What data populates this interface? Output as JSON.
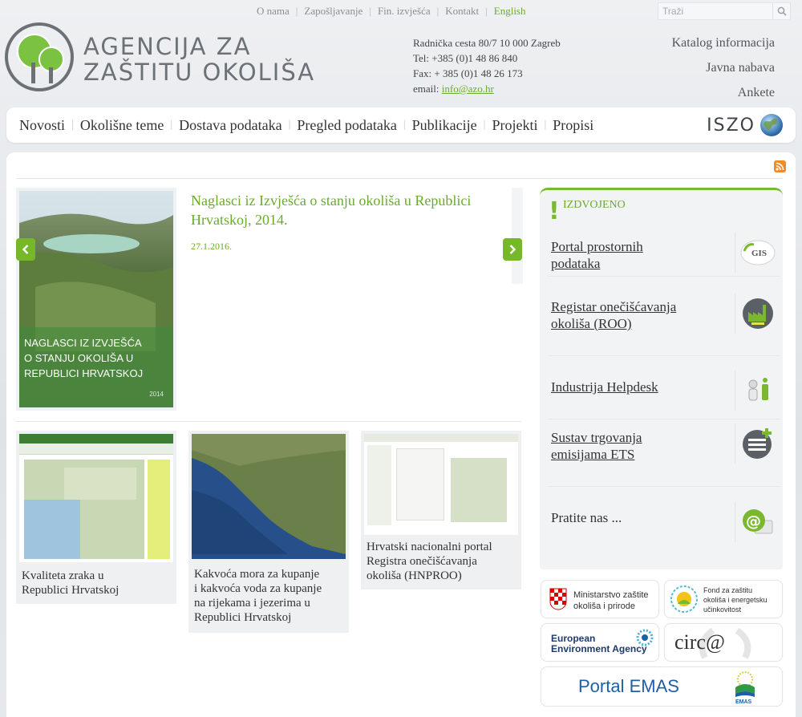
{
  "topnav": {
    "items": [
      "O nama",
      "Zapošljavanje",
      "Fin. izvješća",
      "Kontakt",
      "English"
    ],
    "search_placeholder": "Traži"
  },
  "header": {
    "brand_line1": "AGENCIJA ZA",
    "brand_line2": "ZAŠTITU OKOLIŠA",
    "address": "Radnička cesta 80/7 10 000 Zagreb",
    "tel": "Tel: +385 (0)1 48 86 840",
    "fax": "Fax: + 385 (0)1 48 26 173",
    "email_label": "email:",
    "email": "info@azo.hr",
    "quicklinks": [
      "Katalog informacija",
      "Javna nabava",
      "Ankete"
    ]
  },
  "mainnav": {
    "items": [
      "Novosti",
      "Okolišne teme",
      "Dostava podataka",
      "Pregled podataka",
      "Publikacije",
      "Projekti",
      "Propisi"
    ],
    "iszo": "ISZO"
  },
  "featured": {
    "title": "Naglasci iz Izvješća o stanju okoliša u Republici Hrvatskoj, 2014.",
    "date": "27.1.2016.",
    "cover_text": [
      "NAGLASCI IZ IZVJEŠĆA",
      "O STANJU OKOLIŠA U",
      "REPUBLICI HRVATSKOJ"
    ],
    "cover_year": "2014"
  },
  "cards": [
    {
      "caption": [
        "Kvaliteta zraka u",
        "Republici Hrvatskoj"
      ]
    },
    {
      "caption": [
        "Kakvoća mora za kupanje",
        "i kakvoća voda za kupanje",
        "na rijekama i jezerima u",
        "Republici Hrvatskoj"
      ]
    },
    {
      "caption": [
        "Hrvatski nacionalni portal",
        "Registra onečišćavanja",
        "okoliša (HNPROO)"
      ]
    }
  ],
  "sidebar": {
    "heading": "IZDVOJENO",
    "items": [
      {
        "label": [
          "Portal prostornih",
          "podataka"
        ],
        "icon_text": "GIS"
      },
      {
        "label": [
          "Registar onečišćavanja",
          "okoliša (ROO)"
        ],
        "icon_text": ""
      },
      {
        "label": [
          "Industrija Helpdesk"
        ],
        "icon_text": ""
      },
      {
        "label": [
          "Sustav trgovanja",
          "emisijama ETS"
        ],
        "icon_text": ""
      },
      {
        "label": [
          "Pratite nas ..."
        ],
        "icon_text": "@"
      }
    ]
  },
  "partners": {
    "ministry": [
      "Ministarstvo zaštite",
      "okoliša i prirode"
    ],
    "fund": [
      "Fond za zaštitu",
      "okoliša i energetsku",
      "učinkovitost"
    ],
    "eea": [
      "European",
      "Environment Agency"
    ],
    "circa": "circ@",
    "emas": "Portal EMAS",
    "emas_badge": "EMAS"
  },
  "colors": {
    "accent": "#76b82a",
    "link_green": "#6aab2e",
    "text": "#333333"
  }
}
